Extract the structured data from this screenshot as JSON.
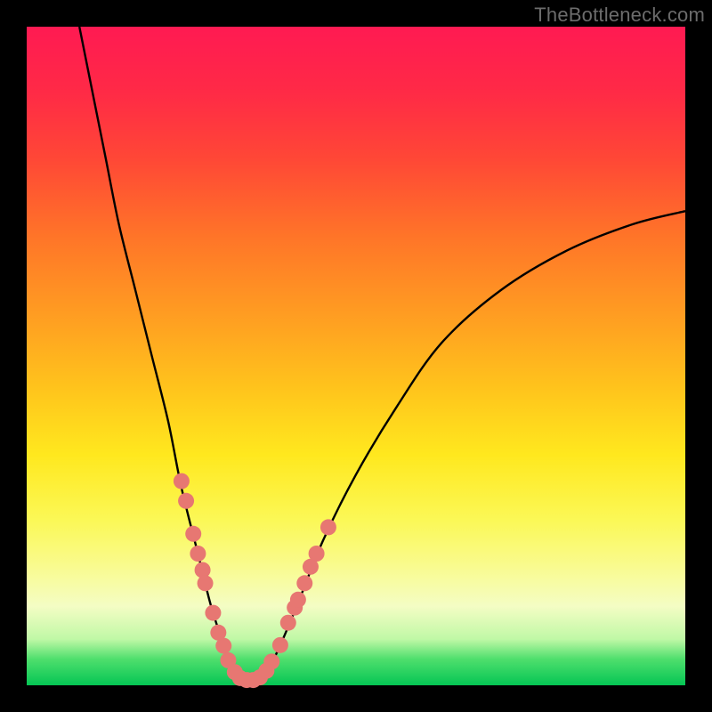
{
  "watermark": "TheBottleneck.com",
  "chart_data": {
    "type": "line",
    "title": "",
    "xlabel": "",
    "ylabel": "",
    "xlim": [
      0,
      100
    ],
    "ylim": [
      0,
      100
    ],
    "curve": {
      "name": "bottleneck-curve",
      "points": [
        {
          "x": 8,
          "y": 100
        },
        {
          "x": 10,
          "y": 90
        },
        {
          "x": 12,
          "y": 80
        },
        {
          "x": 14,
          "y": 70
        },
        {
          "x": 16.5,
          "y": 60
        },
        {
          "x": 19,
          "y": 50
        },
        {
          "x": 21.5,
          "y": 40
        },
        {
          "x": 23.5,
          "y": 30
        },
        {
          "x": 26,
          "y": 20
        },
        {
          "x": 28,
          "y": 12
        },
        {
          "x": 30,
          "y": 6
        },
        {
          "x": 32,
          "y": 1.5
        },
        {
          "x": 34,
          "y": 0.7
        },
        {
          "x": 36,
          "y": 1.5
        },
        {
          "x": 38,
          "y": 5
        },
        {
          "x": 41,
          "y": 12
        },
        {
          "x": 45,
          "y": 22
        },
        {
          "x": 50,
          "y": 32
        },
        {
          "x": 56,
          "y": 42
        },
        {
          "x": 63,
          "y": 52
        },
        {
          "x": 72,
          "y": 60
        },
        {
          "x": 82,
          "y": 66
        },
        {
          "x": 92,
          "y": 70
        },
        {
          "x": 100,
          "y": 72
        }
      ]
    },
    "markers_left": [
      {
        "x": 23.5,
        "y": 31
      },
      {
        "x": 24.2,
        "y": 28
      },
      {
        "x": 25.3,
        "y": 23
      },
      {
        "x": 26.0,
        "y": 20
      },
      {
        "x": 26.7,
        "y": 17.5
      },
      {
        "x": 27.1,
        "y": 15.5
      },
      {
        "x": 28.3,
        "y": 11
      },
      {
        "x": 29.1,
        "y": 8
      },
      {
        "x": 29.9,
        "y": 6
      },
      {
        "x": 30.6,
        "y": 3.8
      },
      {
        "x": 31.6,
        "y": 2
      }
    ],
    "markers_bottom": [
      {
        "x": 32.4,
        "y": 1.1
      },
      {
        "x": 33.4,
        "y": 0.8
      },
      {
        "x": 34.4,
        "y": 0.8
      },
      {
        "x": 35.4,
        "y": 1.2
      }
    ],
    "markers_right": [
      {
        "x": 36.4,
        "y": 2.2
      },
      {
        "x": 37.2,
        "y": 3.6
      },
      {
        "x": 38.5,
        "y": 6.1
      },
      {
        "x": 39.7,
        "y": 9.5
      },
      {
        "x": 40.7,
        "y": 11.8
      },
      {
        "x": 41.2,
        "y": 13
      },
      {
        "x": 42.2,
        "y": 15.5
      },
      {
        "x": 43.1,
        "y": 18
      },
      {
        "x": 44.0,
        "y": 20
      },
      {
        "x": 45.8,
        "y": 24
      }
    ],
    "marker_radius": 9
  }
}
